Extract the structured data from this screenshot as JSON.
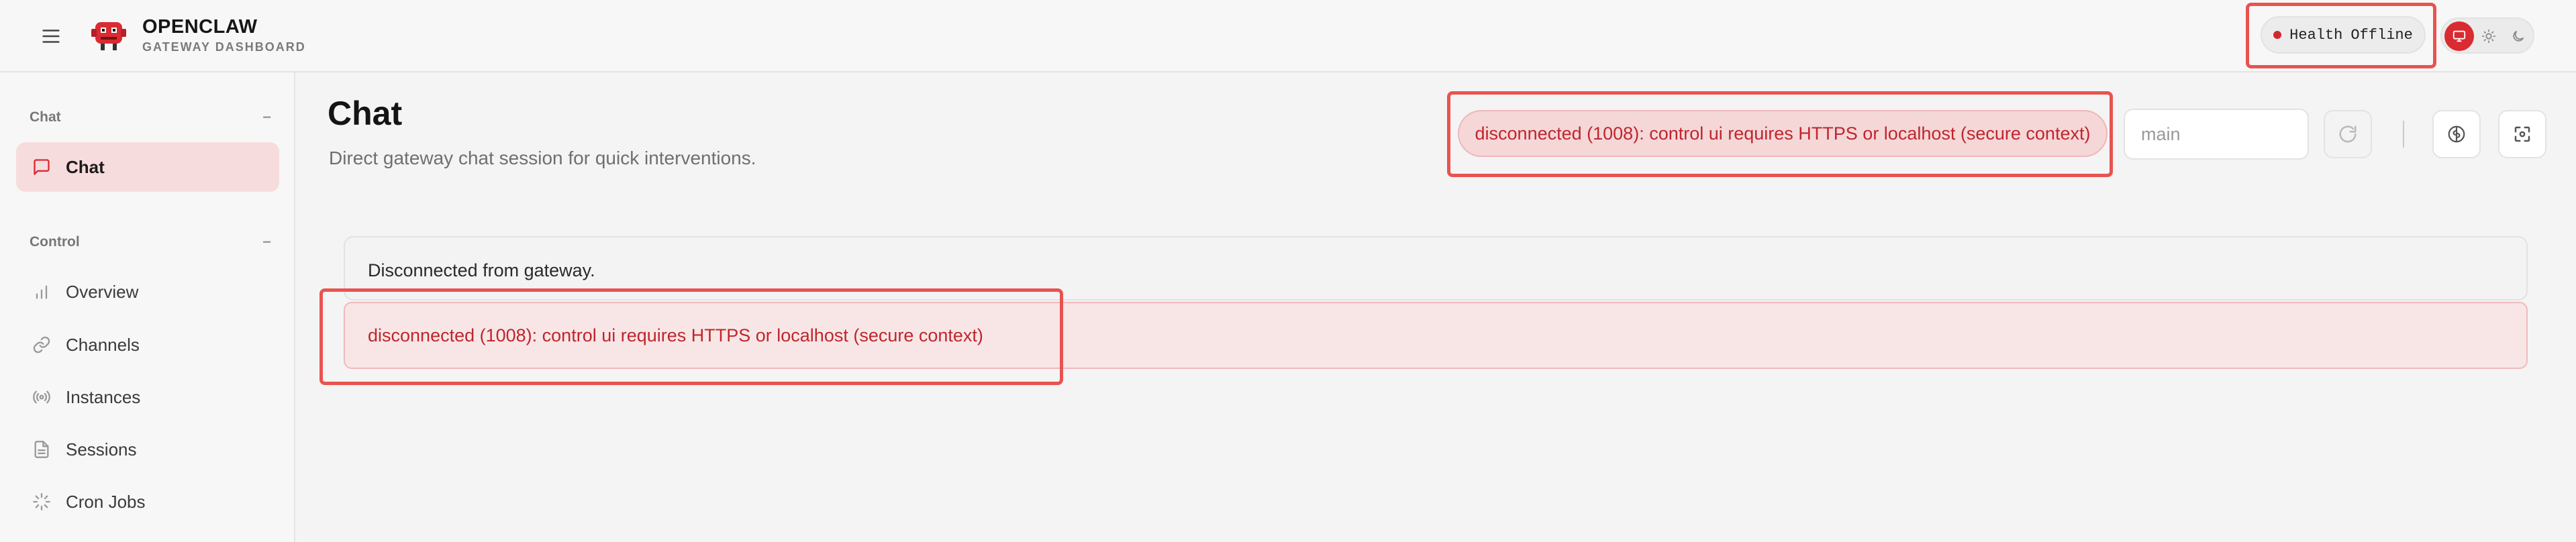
{
  "header": {
    "brand_title": "OPENCLAW",
    "brand_subtitle": "GATEWAY DASHBOARD",
    "health_label": "Health",
    "health_status": "Offline",
    "theme_options": [
      "system",
      "light",
      "dark"
    ],
    "theme_selected": "system"
  },
  "sidebar": {
    "groups": [
      {
        "title": "Chat",
        "collapse_glyph": "−",
        "items": [
          {
            "label": "Chat",
            "icon": "message-square-icon",
            "active": true
          }
        ]
      },
      {
        "title": "Control",
        "collapse_glyph": "−",
        "items": [
          {
            "label": "Overview",
            "icon": "bar-chart-icon"
          },
          {
            "label": "Channels",
            "icon": "link-icon"
          },
          {
            "label": "Instances",
            "icon": "radio-icon"
          },
          {
            "label": "Sessions",
            "icon": "file-text-icon"
          },
          {
            "label": "Cron Jobs",
            "icon": "loader-icon"
          }
        ]
      }
    ]
  },
  "main": {
    "title": "Chat",
    "subtitle": "Direct gateway chat session for quick interventions.",
    "connection_status": "disconnected (1008): control ui requires HTTPS or localhost (secure context)",
    "session_input": {
      "value": "",
      "placeholder": "main"
    },
    "notice": "Disconnected from gateway.",
    "error": "disconnected (1008): control ui requires HTTPS or localhost (secure context)"
  },
  "colors": {
    "accent": "#d92b32",
    "error_text": "#c0252c",
    "error_bg": "#f8e6e6",
    "active_nav_bg": "#f7dcdd",
    "annotation": "#e9534f"
  }
}
